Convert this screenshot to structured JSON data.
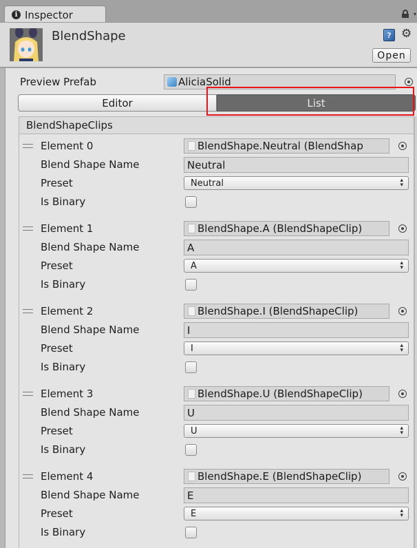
{
  "tab": {
    "label": "Inspector"
  },
  "header": {
    "title": "BlendShape",
    "open_label": "Open"
  },
  "preview_prefab": {
    "label": "Preview Prefab",
    "value": "AliciaSolid"
  },
  "mode_tabs": [
    {
      "label": "Editor",
      "selected": false
    },
    {
      "label": "List",
      "selected": true
    }
  ],
  "list": {
    "header": "BlendShapeClips",
    "field_labels": {
      "blend_shape_name": "Blend Shape Name",
      "preset": "Preset",
      "is_binary": "Is Binary"
    },
    "elements": [
      {
        "label": "Element 0",
        "clip": "BlendShape.Neutral (BlendShap",
        "name": "Neutral",
        "preset": "Neutral",
        "is_binary": false
      },
      {
        "label": "Element 1",
        "clip": "BlendShape.A (BlendShapeClip)",
        "name": "A",
        "preset": "A",
        "is_binary": false
      },
      {
        "label": "Element 2",
        "clip": "BlendShape.I (BlendShapeClip)",
        "name": "I",
        "preset": "I",
        "is_binary": false
      },
      {
        "label": "Element 3",
        "clip": "BlendShape.U (BlendShapeClip)",
        "name": "U",
        "preset": "U",
        "is_binary": false
      },
      {
        "label": "Element 4",
        "clip": "BlendShape.E (BlendShapeClip)",
        "name": "E",
        "preset": "E",
        "is_binary": false
      }
    ]
  },
  "colors": {
    "highlight": "#e8141a",
    "selected_tab": "#6a6a6a"
  }
}
